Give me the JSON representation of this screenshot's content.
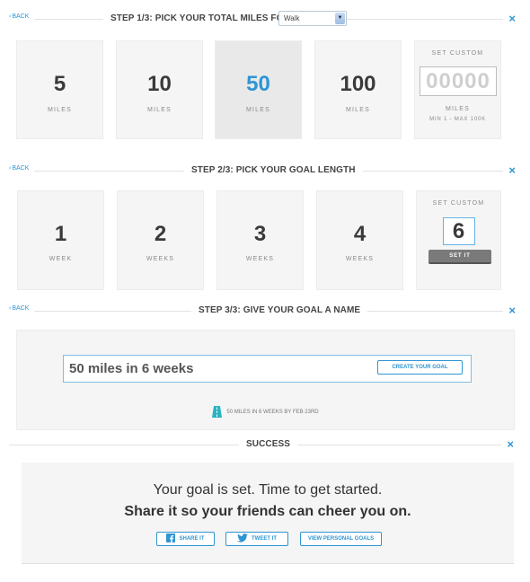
{
  "step1": {
    "back_label": "BACK",
    "title": "STEP 1/3: PICK YOUR TOTAL MILES FOR:",
    "activity_selected": "Walk",
    "close_glyph": "×",
    "options": [
      {
        "value": "5",
        "unit": "MILES",
        "selected": false
      },
      {
        "value": "10",
        "unit": "MILES",
        "selected": false
      },
      {
        "value": "50",
        "unit": "MILES",
        "selected": true
      },
      {
        "value": "100",
        "unit": "MILES",
        "selected": false
      }
    ],
    "custom": {
      "label": "SET CUSTOM",
      "placeholder": "00000",
      "unit": "MILES",
      "range": "MIN 1 - MAX 100K"
    }
  },
  "step2": {
    "back_label": "BACK",
    "title": "STEP 2/3: PICK YOUR GOAL LENGTH",
    "close_glyph": "×",
    "options": [
      {
        "value": "1",
        "unit": "WEEK"
      },
      {
        "value": "2",
        "unit": "WEEKS"
      },
      {
        "value": "3",
        "unit": "WEEKS"
      },
      {
        "value": "4",
        "unit": "WEEKS"
      }
    ],
    "custom": {
      "label": "SET CUSTOM",
      "value": "6",
      "button": "SET IT"
    }
  },
  "step3": {
    "back_label": "BACK",
    "title": "STEP 3/3: GIVE YOUR GOAL A NAME",
    "close_glyph": "×",
    "goal_name": "50 miles in 6 weeks",
    "create_button": "CREATE YOUR GOAL",
    "summary": "50 MILES IN 6 WEEKS BY FEB 23RD",
    "summary_icon": "road-icon"
  },
  "success": {
    "title": "SUCCESS",
    "close_glyph": "×",
    "line1": "Your goal is set. Time to get started.",
    "line2": "Share it so your friends can cheer you on.",
    "buttons": {
      "share": "SHARE IT",
      "tweet": "TWEET IT",
      "view": "VIEW PERSONAL GOALS"
    }
  },
  "colors": {
    "accent": "#2e95d3",
    "card_bg": "#f5f5f5",
    "selected_bg": "#e9e9e9",
    "road_icon": "#2bb3c0"
  }
}
